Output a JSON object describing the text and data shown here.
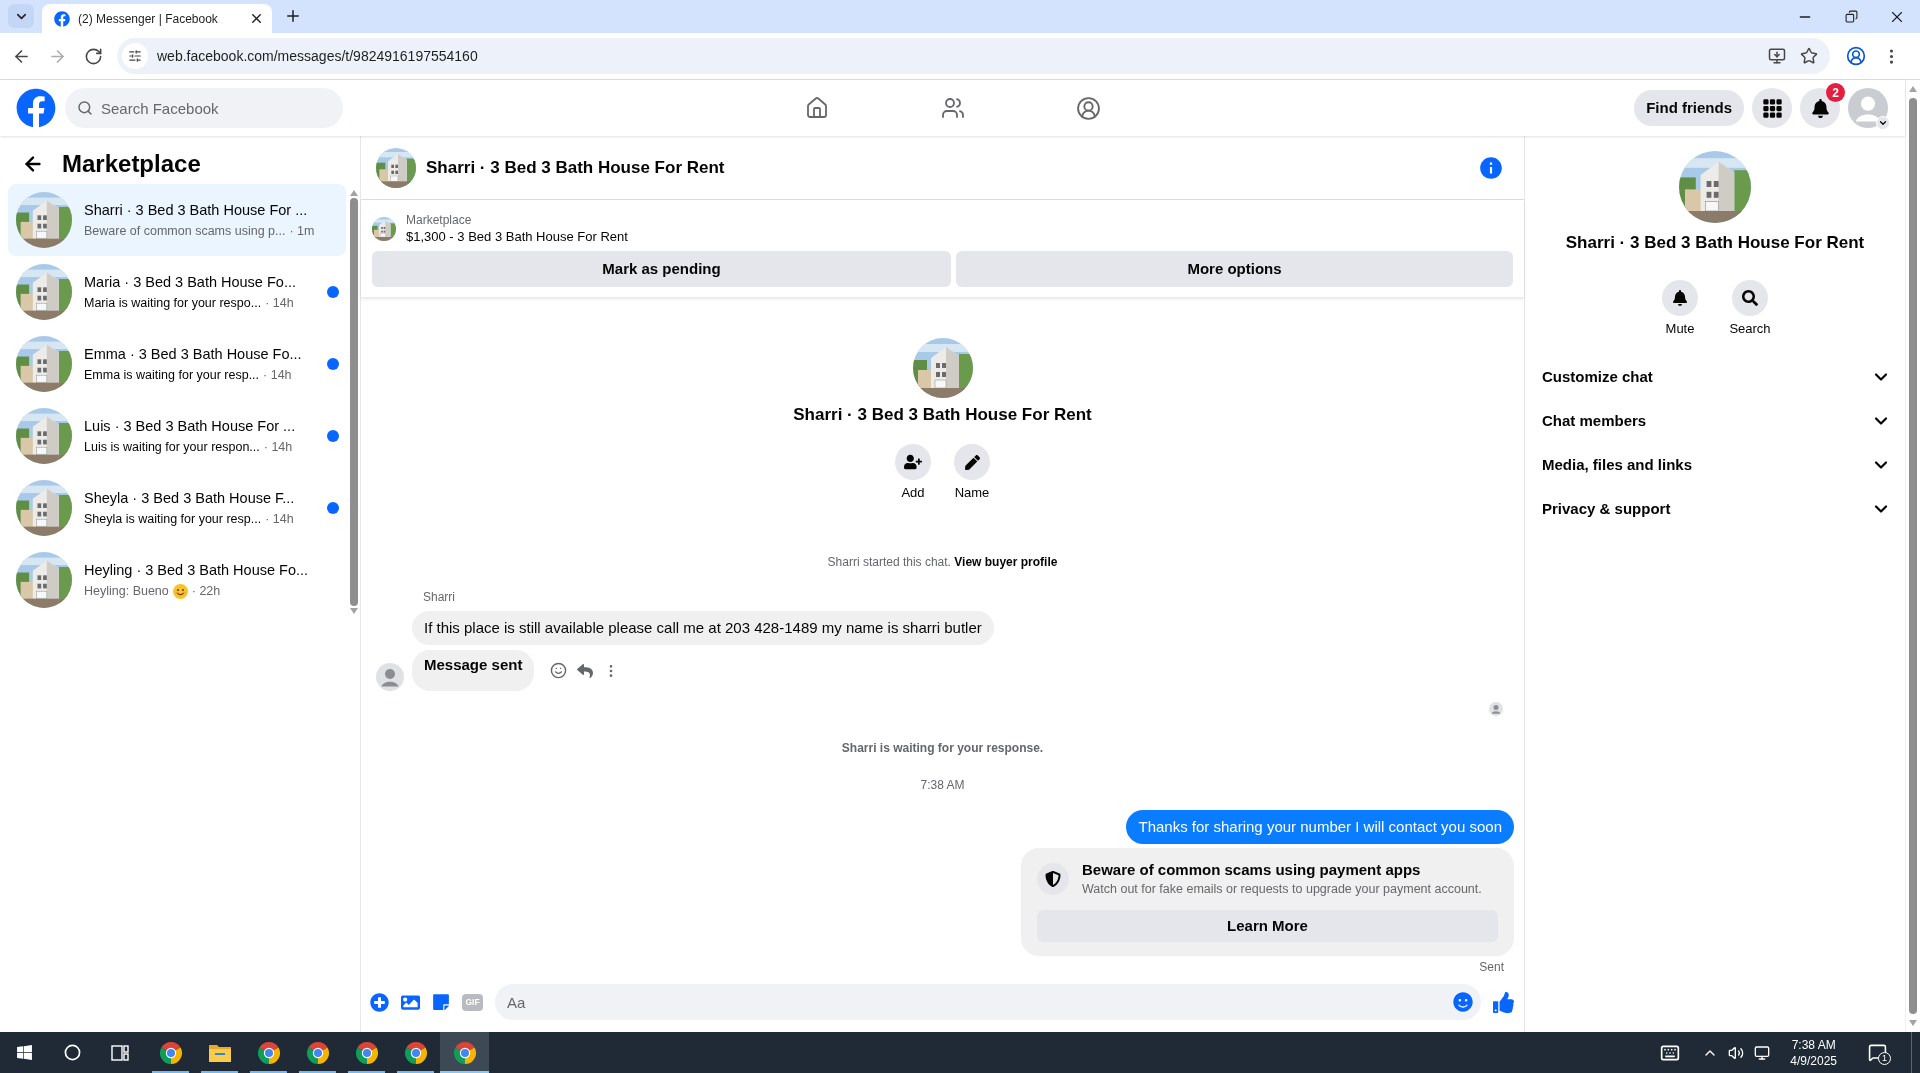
{
  "browser": {
    "tab_title": "(2) Messenger | Facebook",
    "url": "web.facebook.com/messages/t/9824916197554160",
    "nav": [
      {
        "kind": "back",
        "disabled": false
      },
      {
        "kind": "forward",
        "disabled": true
      },
      {
        "kind": "reload",
        "disabled": false
      }
    ]
  },
  "header": {
    "search_placeholder": "Search Facebook",
    "find_friends": "Find friends",
    "notification_count": "2"
  },
  "sidebar": {
    "title": "Marketplace",
    "conversations": [
      {
        "title": "Sharri · 3 Bed 3 Bath House For ...",
        "preview": "Beware of common scams using p...",
        "time": "· 1m",
        "unread": false,
        "emoji": false,
        "selected": true
      },
      {
        "title": "Maria · 3 Bed 3 Bath House Fo...",
        "preview": "Maria is waiting for your respo...",
        "time": "· 14h",
        "unread": true,
        "emoji": false,
        "selected": false
      },
      {
        "title": "Emma · 3 Bed 3 Bath House Fo...",
        "preview": "Emma is waiting for your resp...",
        "time": "· 14h",
        "unread": true,
        "emoji": false,
        "selected": false
      },
      {
        "title": "Luis · 3 Bed 3 Bath House For ...",
        "preview": "Luis is waiting for your respon...",
        "time": "· 14h",
        "unread": true,
        "emoji": false,
        "selected": false
      },
      {
        "title": "Sheyla · 3 Bed 3 Bath House F...",
        "preview": "Sheyla is waiting for your resp...",
        "time": "· 14h",
        "unread": true,
        "emoji": false,
        "selected": false
      },
      {
        "title": "Heyling · 3 Bed 3 Bath House Fo...",
        "preview": "Heyling: Bueno",
        "time": "· 22h",
        "unread": false,
        "emoji": true,
        "selected": false
      }
    ]
  },
  "chat": {
    "title": "Sharri · 3 Bed 3 Bath House For Rent",
    "listing": {
      "source": "Marketplace",
      "title": "$1,300 - 3 Bed 3 Bath House For Rent"
    },
    "actions": [
      "Mark as pending",
      "More options"
    ],
    "intro": {
      "title": "Sharri · 3 Bed 3 Bath House For Rent",
      "buttons": [
        {
          "kind": "add",
          "label": "Add"
        },
        {
          "kind": "name",
          "label": "Name"
        }
      ]
    },
    "messages": [
      {
        "kind": "chat_start",
        "text": "Sharri started this chat.",
        "link": "View buyer profile"
      },
      {
        "kind": "sender",
        "text": "Sharri"
      },
      {
        "kind": "incoming",
        "text": "If this place is still available please call me at 203 428-1489 my name is sharri butler",
        "bold": false,
        "last": false
      },
      {
        "kind": "incoming",
        "text": "Message sent",
        "bold": true,
        "last": true
      },
      {
        "kind": "seen"
      },
      {
        "kind": "notice",
        "text": "Sharri is waiting for your response."
      },
      {
        "kind": "time",
        "text": "7:38 AM"
      },
      {
        "kind": "outgoing",
        "text": "Thanks for sharing your number I will contact you soon"
      },
      {
        "kind": "warning",
        "title": "Beware of common scams using payment apps",
        "text": "Watch out for fake emails or requests to upgrade your payment account.",
        "button": "Learn More"
      },
      {
        "kind": "status",
        "text": "Sent"
      }
    ],
    "composer": {
      "gif_label": "GIF",
      "placeholder": "Aa"
    }
  },
  "details": {
    "title": "Sharri · 3 Bed 3 Bath House For Rent",
    "buttons": [
      {
        "kind": "mute",
        "label": "Mute"
      },
      {
        "kind": "search",
        "label": "Search"
      }
    ],
    "sections": [
      {
        "label": "Customize chat",
        "expanded": false
      },
      {
        "label": "Chat members",
        "expanded": false
      },
      {
        "label": "Media, files and links",
        "expanded": false
      },
      {
        "label": "Privacy & support",
        "expanded": false
      }
    ]
  },
  "taskbar": {
    "apps": [
      {
        "kind": "chrome",
        "selected": false
      },
      {
        "kind": "folder",
        "selected": false
      },
      {
        "kind": "chrome",
        "selected": false
      },
      {
        "kind": "chrome",
        "selected": false
      },
      {
        "kind": "chrome",
        "selected": false
      },
      {
        "kind": "chrome",
        "selected": false
      },
      {
        "kind": "chrome",
        "selected": true
      }
    ],
    "time": "7:38 AM",
    "date": "4/9/2025",
    "notification_count": "1"
  }
}
